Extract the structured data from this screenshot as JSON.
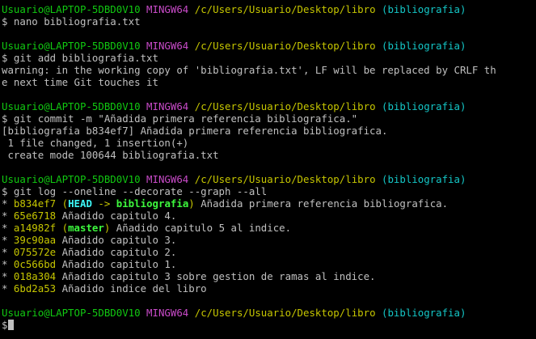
{
  "prompt": {
    "user_host": "Usuario@LAPTOP-5DBD0V10",
    "system": "MINGW64",
    "path": "/c/Users/Usuario/Desktop/libro",
    "branch": "(bibliografia)"
  },
  "blocks": [
    {
      "command": "$ nano bibliografia.txt",
      "output": []
    },
    {
      "command": "$ git add bibliografia.txt",
      "output": [
        "warning: in the working copy of 'bibliografia.txt', LF will be replaced by CRLF th",
        "e next time Git touches it"
      ]
    },
    {
      "command": "$ git commit -m \"Añadida primera referencia bibliografica.\"",
      "output": [
        "[bibliografia b834ef7] Añadida primera referencia bibliografica.",
        " 1 file changed, 1 insertion(+)",
        " create mode 100644 bibliografia.txt"
      ]
    },
    {
      "command": "$ git log --oneline --decorate --graph --all"
    }
  ],
  "log": [
    {
      "graph": "* ",
      "hash": "b834ef7",
      "refs": {
        "open": "(",
        "head": "HEAD",
        "arrow": " -> ",
        "branch": "bibliografia",
        "close": ")"
      },
      "message": " Añadida primera referencia bibliografica."
    },
    {
      "graph": "* ",
      "hash": "65e6718",
      "message": " Añadido capitulo 4."
    },
    {
      "graph": "* ",
      "hash": "a14982f",
      "refs": {
        "open": "(",
        "branch": "master",
        "close": ")"
      },
      "message": " Añadido capitulo 5 al indice."
    },
    {
      "graph": "* ",
      "hash": "39c90aa",
      "message": " Añadido capitulo 3."
    },
    {
      "graph": "* ",
      "hash": "075572e",
      "message": " Añadido capitulo 2."
    },
    {
      "graph": "* ",
      "hash": "0c566bd",
      "message": " Añadido capitulo 1."
    },
    {
      "graph": "* ",
      "hash": "018a304",
      "message": " Añadido capitulo 3 sobre gestion de ramas al indice."
    },
    {
      "graph": "* ",
      "hash": "6bd2a53",
      "message": " Añadido indice del libro"
    }
  ],
  "final_prompt": "$"
}
